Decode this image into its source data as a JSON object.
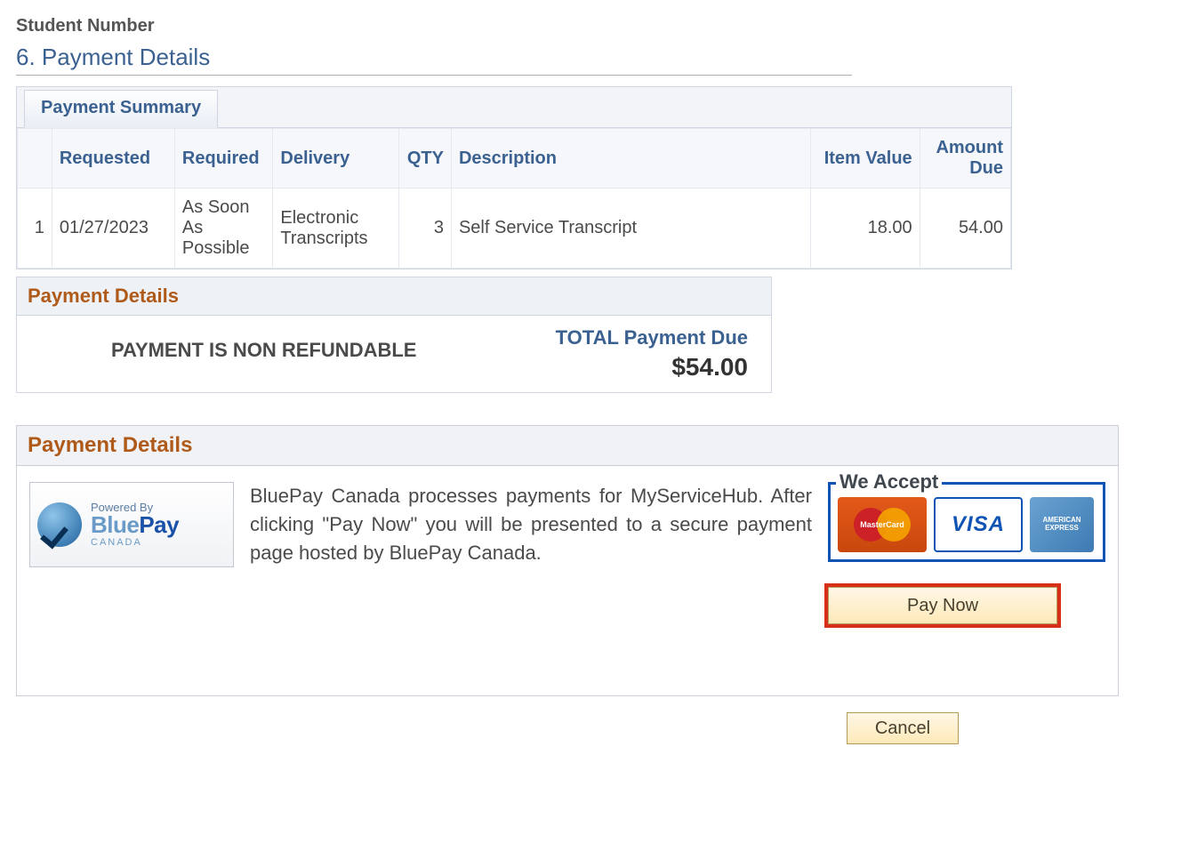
{
  "header": {
    "student_number_label": "Student Number",
    "section_title": "6. Payment Details"
  },
  "summary": {
    "tab_label": "Payment Summary",
    "columns": {
      "index": "",
      "requested": "Requested",
      "required": "Required",
      "delivery": "Delivery",
      "qty": "QTY",
      "description": "Description",
      "item_value": "Item Value",
      "amount_due": "Amount Due"
    },
    "rows": [
      {
        "index": "1",
        "requested": "01/27/2023",
        "required": "As Soon As Possible",
        "delivery": "Electronic Transcripts",
        "qty": "3",
        "description": "Self Service Transcript",
        "item_value": "18.00",
        "amount_due": "54.00"
      }
    ]
  },
  "details_small": {
    "header": "Payment Details",
    "nonrefund_text": "PAYMENT IS NON REFUNDABLE",
    "total_label": "TOTAL Payment Due",
    "total_amount": "$54.00"
  },
  "lower": {
    "header": "Payment Details",
    "logo": {
      "powered": "Powered By",
      "brand_blue": "Blue",
      "brand_pay": "Pay",
      "canada": "CANADA"
    },
    "description": "BluePay Canada processes payments for MyServiceHub. After clicking \"Pay Now\" you will be presented to a secure payment page hosted by BluePay Canada.",
    "we_accept_label": "We Accept",
    "cards": {
      "mastercard": "MasterCard",
      "visa": "VISA",
      "amex": "AMERICAN EXPRESS"
    },
    "pay_now_label": "Pay Now"
  },
  "cancel_label": "Cancel"
}
